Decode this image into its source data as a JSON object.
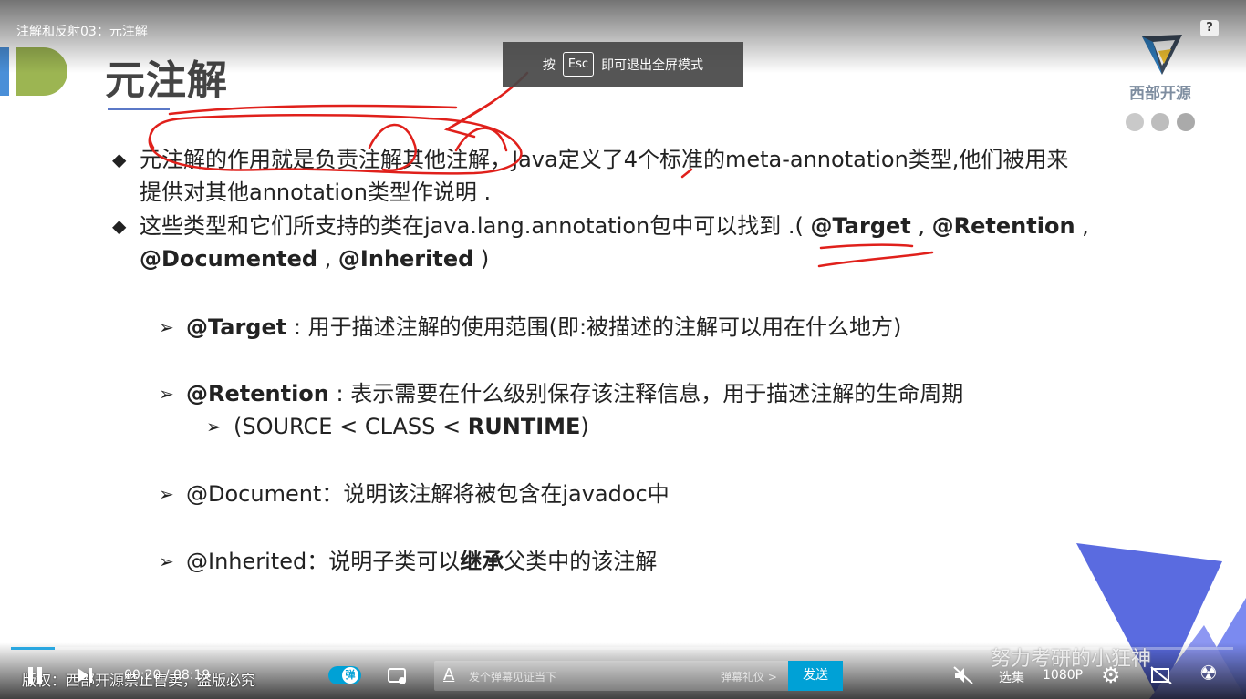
{
  "player": {
    "video_title": "注解和反射03：元注解",
    "help": "?",
    "esc_toast": {
      "prefix": "按",
      "key": "Esc",
      "suffix": "即可退出全屏模式"
    },
    "time_current": "00:20",
    "time_sep": "/",
    "time_total": "08:19",
    "progress_fraction": 0.036,
    "danmaku_toggle": "弹",
    "danmaku_placeholder": "发个弹幕见证当下",
    "danmaku_etiquette": "弹幕礼仪 >",
    "send_label": "发送",
    "select_episode": "选集",
    "quality": "1080P",
    "scrolling_text": "版权：西部开源禁止售卖，盗版必究",
    "watermark": "努力考研的小狂神"
  },
  "slide": {
    "title": "元注解",
    "logo_text": "西部开源",
    "bullets": [
      {
        "line1": "元注解的作用就是负责注解其他注解，Java定义了4个标准的meta-annotation类型,他们被用来",
        "line2": "提供对其他annotation类型作说明 ."
      },
      {
        "line1_a": "这些类型和它们所支持的类在java.lang.annotation包中可以找到 .( ",
        "target": "@Target",
        "comma1": " , ",
        "retention": "@Retention",
        "comma2": " ,",
        "documented": "@Documented",
        "comma3": " , ",
        "inherited": "@Inherited",
        "close": " )"
      }
    ],
    "items": [
      {
        "name": "@Target",
        "desc": " : 用于描述注解的使用范围(即:被描述的注解可以用在什么地方)"
      },
      {
        "name": "@Retention",
        "desc": " : 表示需要在什么级别保存该注释信息，用于描述注解的生命周期"
      },
      {
        "name": "",
        "desc": "@Document：说明该注解将被包含在javadoc中"
      },
      {
        "prefix": "@Inherited：说明子类可以",
        "bold": "继承",
        "suffix": "父类中的该注解"
      }
    ],
    "retention_sub": {
      "a": "(SOURCE < CLASS  <  ",
      "b": "RUNTIME",
      "c": ")"
    }
  },
  "colors": {
    "accent_blue": "#4a8fd8",
    "accent_green": "#9cb552",
    "annotation_red": "#e0201b",
    "send_blue": "#00a1d6",
    "deco_blue": "#5a6be0"
  }
}
